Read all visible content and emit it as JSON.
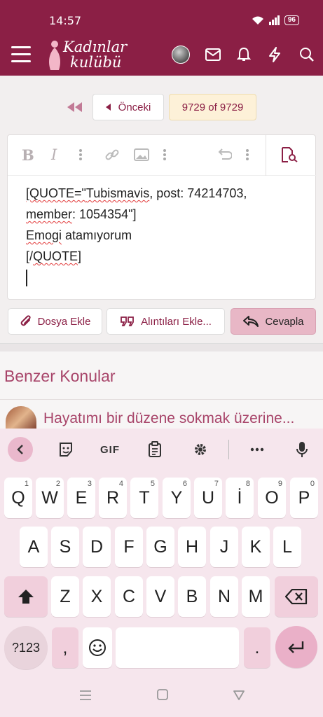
{
  "status": {
    "time": "14:57",
    "battery": "96"
  },
  "header": {
    "logo_line1": "Kadınlar",
    "logo_line2": "kulübü",
    "icons": [
      "menu-icon",
      "avatar",
      "mail-icon",
      "bell-icon",
      "bolt-icon",
      "search-icon"
    ]
  },
  "pagination": {
    "prev_label": "Önceki",
    "current": "9729 of 9729"
  },
  "editor": {
    "toolbar_icons": [
      "bold-icon",
      "italic-icon",
      "more-icon",
      "link-icon",
      "image-icon",
      "more-icon",
      "undo-icon",
      "more-icon",
      "preview-icon"
    ],
    "line1_a": "[QUOTE=\"",
    "line1_b": "Tubismavis",
    "line1_c": ", post: 74214703,",
    "line2_a": "member",
    "line2_b": ": 1054354\"]",
    "line3_a": "Emogi",
    "line3_b": " ",
    "line3_c": "atamıyorum",
    "line4_a": "[/",
    "line4_b": "QUOTE",
    "line4_c": "]"
  },
  "actions": {
    "attach": "Dosya Ekle",
    "quotes": "Alıntıları Ekle...",
    "reply": "Cevapla"
  },
  "similar": {
    "title": "Benzer Konular",
    "item1": "Hayatımı bir düzene sokmak üzerine..."
  },
  "keyboard": {
    "gif": "GIF",
    "row1": [
      "Q",
      "W",
      "E",
      "R",
      "T",
      "Y",
      "U",
      "İ",
      "O",
      "P"
    ],
    "row1_nums": [
      "1",
      "2",
      "3",
      "4",
      "5",
      "6",
      "7",
      "8",
      "9",
      "0"
    ],
    "row2": [
      "A",
      "S",
      "D",
      "F",
      "G",
      "H",
      "J",
      "K",
      "L"
    ],
    "row3": [
      "Z",
      "X",
      "C",
      "V",
      "B",
      "N",
      "M"
    ],
    "sym": "?123",
    "comma": ",",
    "period": "."
  }
}
